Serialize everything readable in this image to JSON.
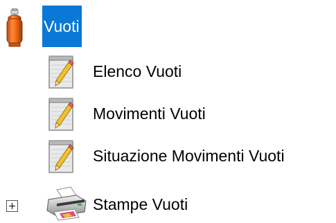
{
  "tree": {
    "root": {
      "label": "Vuoti",
      "icon": "gas-cylinder-icon",
      "selected": true,
      "accent_color": "#0a78d7"
    },
    "children": [
      {
        "label": "Elenco Vuoti",
        "icon": "notepad-pencil-icon"
      },
      {
        "label": "Movimenti Vuoti",
        "icon": "notepad-pencil-icon"
      },
      {
        "label": "Situazione Movimenti Vuoti",
        "icon": "notepad-pencil-icon"
      },
      {
        "label": "Stampe Vuoti",
        "icon": "printer-icon",
        "expander": "plus-box-icon",
        "expanded": false
      }
    ]
  }
}
